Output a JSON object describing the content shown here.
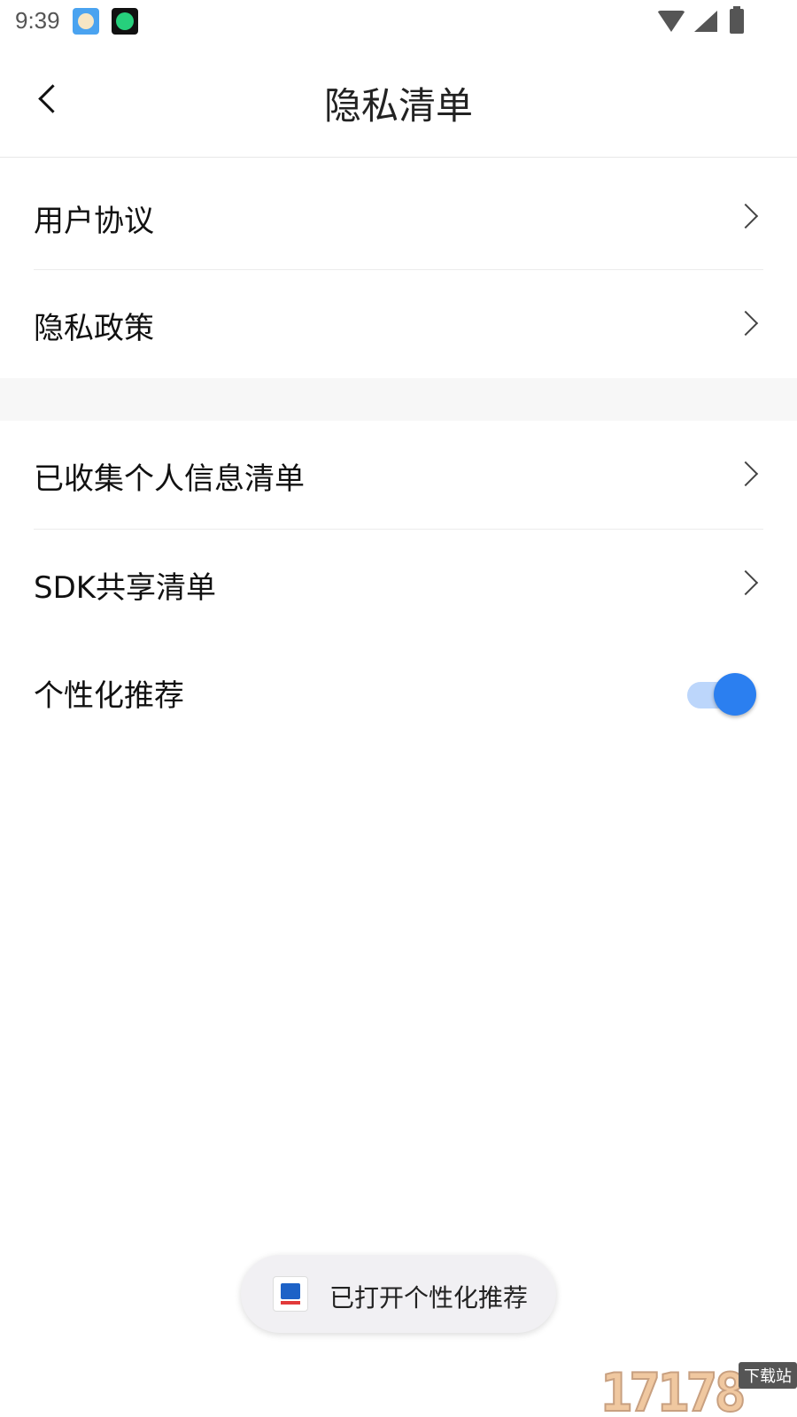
{
  "status_bar": {
    "time": "9:39"
  },
  "header": {
    "title": "隐私清单"
  },
  "section1": {
    "items": [
      {
        "label": "用户协议"
      },
      {
        "label": "隐私政策"
      }
    ]
  },
  "section2": {
    "items": [
      {
        "label": "已收集个人信息清单"
      },
      {
        "label": "SDK共享清单"
      }
    ],
    "toggle": {
      "label": "个性化推荐",
      "on": true
    }
  },
  "toast": {
    "text": "已打开个性化推荐"
  },
  "colors": {
    "accent": "#2b7ff0",
    "track": "#bcd6fb"
  }
}
